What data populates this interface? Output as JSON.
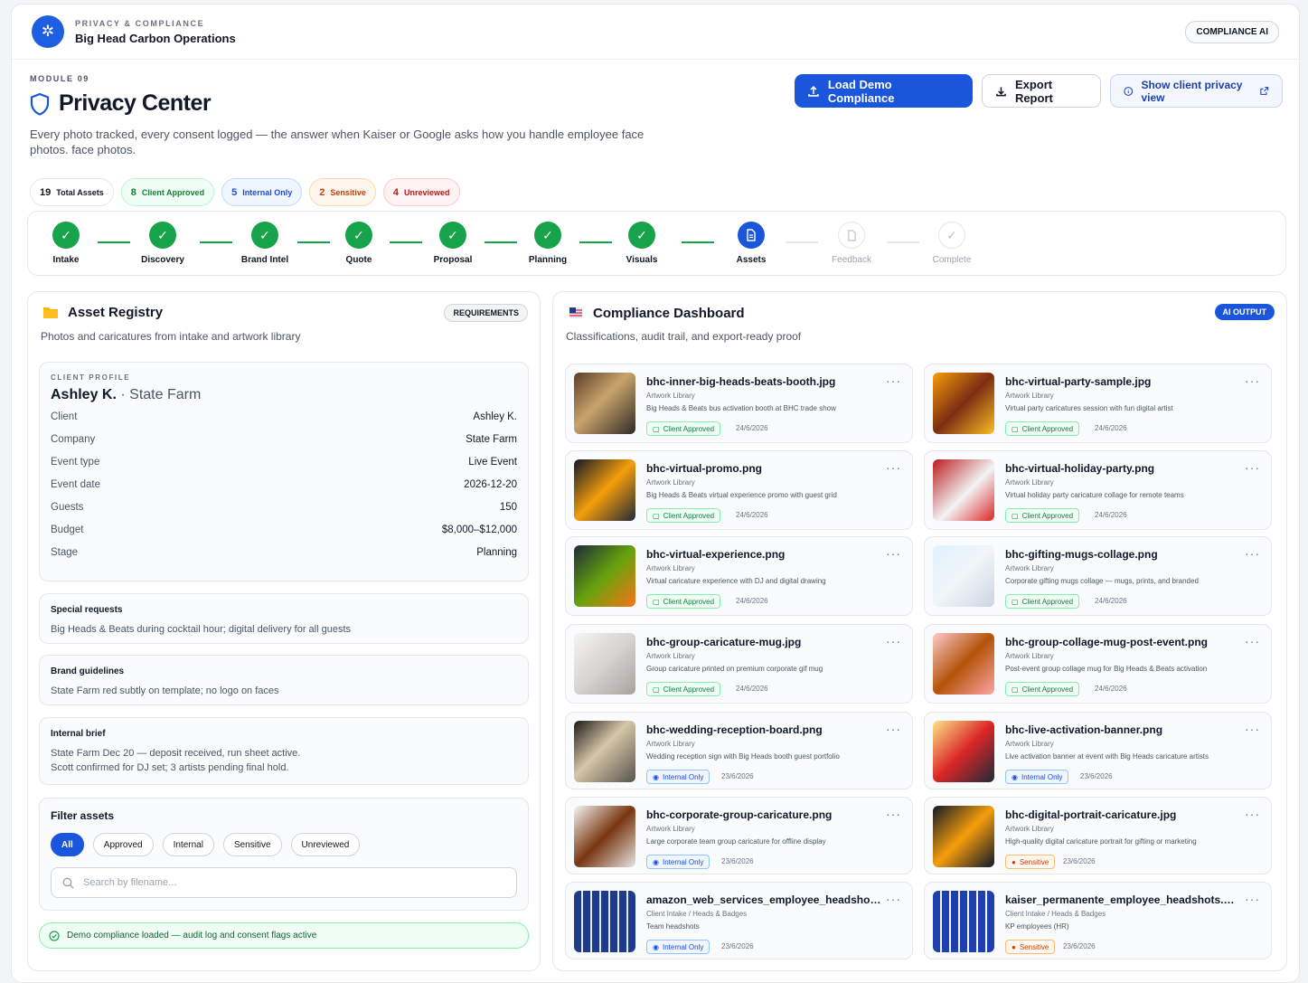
{
  "header": {
    "logo_glyph": "✲",
    "eyebrow": "PRIVACY & COMPLIANCE",
    "title": "Big Head Carbon Operations",
    "badge": "COMPLIANCE AI"
  },
  "page": {
    "module": "MODULE 09",
    "title": "Privacy Center",
    "subtitle": "Every photo tracked, every consent logged — the answer when Kaiser or Google asks how you handle employee face photos. face photos."
  },
  "actions": {
    "load_demo": "Load Demo Compliance",
    "export": "Export Report",
    "client_view": "Show client privacy view"
  },
  "stats": [
    {
      "count": "19",
      "label": "Total Assets"
    },
    {
      "count": "8",
      "label": "Client Approved"
    },
    {
      "count": "5",
      "label": "Internal Only"
    },
    {
      "count": "2",
      "label": "Sensitive"
    },
    {
      "count": "4",
      "label": "Unreviewed"
    }
  ],
  "steps": [
    {
      "label": "Intake",
      "state": "done"
    },
    {
      "label": "Discovery",
      "state": "done"
    },
    {
      "label": "Brand Intel",
      "state": "done"
    },
    {
      "label": "Quote",
      "state": "done"
    },
    {
      "label": "Proposal",
      "state": "done"
    },
    {
      "label": "Planning",
      "state": "done"
    },
    {
      "label": "Visuals",
      "state": "done"
    },
    {
      "label": "Assets",
      "state": "active"
    },
    {
      "label": "Feedback",
      "state": "pending"
    },
    {
      "label": "Complete",
      "state": "pending"
    }
  ],
  "registry": {
    "title": "Asset Registry",
    "tag": "REQUIREMENTS",
    "subtitle": "Photos and caricatures from intake and artwork library",
    "profile": {
      "eyebrow": "CLIENT PROFILE",
      "name": "Ashley K.",
      "company_suffix": "· State Farm",
      "rows": [
        {
          "k": "Client",
          "v": "Ashley K."
        },
        {
          "k": "Company",
          "v": "State Farm"
        },
        {
          "k": "Event type",
          "v": "Live Event"
        },
        {
          "k": "Event date",
          "v": "2026-12-20"
        },
        {
          "k": "Guests",
          "v": "150"
        },
        {
          "k": "Budget",
          "v": "$8,000–$12,000"
        },
        {
          "k": "Stage",
          "v": "Planning"
        }
      ]
    },
    "special": {
      "title": "Special requests",
      "text": "Big Heads & Beats during cocktail hour; digital delivery for all guests"
    },
    "brand": {
      "title": "Brand guidelines",
      "text": "State Farm red subtly on template; no logo on faces"
    },
    "brief": {
      "title": "Internal brief",
      "line1": "State Farm Dec 20 — deposit received, run sheet active.",
      "line2": "Scott confirmed for DJ set; 3 artists pending final hold."
    },
    "filter": {
      "title": "Filter assets",
      "chips": [
        "All",
        "Approved",
        "Internal",
        "Sensitive",
        "Unreviewed"
      ],
      "placeholder": "Search by filename..."
    },
    "toast": "Demo compliance loaded — audit log and consent flags active"
  },
  "dashboard": {
    "title": "Compliance Dashboard",
    "tag": "AI OUTPUT",
    "subtitle": "Classifications, audit trail, and export-ready proof",
    "more": "···",
    "assets": [
      {
        "name": "bhc-inner-big-heads-beats-booth.jpg",
        "source": "Artwork Library",
        "desc": "Big Heads & Beats bus activation booth at BHC trade show",
        "status": "Client Approved",
        "kind": "approved",
        "date": "24/6/2026"
      },
      {
        "name": "bhc-virtual-party-sample.jpg",
        "source": "Artwork Library",
        "desc": "Virtual party caricatures session with fun digital artist",
        "status": "Client Approved",
        "kind": "approved",
        "date": "24/6/2026"
      },
      {
        "name": "bhc-virtual-promo.png",
        "source": "Artwork Library",
        "desc": "Big Heads & Beats virtual experience promo with guest grid",
        "status": "Client Approved",
        "kind": "approved",
        "date": "24/6/2026"
      },
      {
        "name": "bhc-virtual-holiday-party.png",
        "source": "Artwork Library",
        "desc": "Virtual holiday party caricature collage for remote teams",
        "status": "Client Approved",
        "kind": "approved",
        "date": "24/6/2026"
      },
      {
        "name": "bhc-virtual-experience.png",
        "source": "Artwork Library",
        "desc": "Virtual caricature experience with DJ and digital drawing",
        "status": "Client Approved",
        "kind": "approved",
        "date": "24/6/2026"
      },
      {
        "name": "bhc-gifting-mugs-collage.png",
        "source": "Artwork Library",
        "desc": "Corporate gifting mugs collage — mugs, prints, and branded",
        "status": "Client Approved",
        "kind": "approved",
        "date": "24/6/2026"
      },
      {
        "name": "bhc-group-caricature-mug.jpg",
        "source": "Artwork Library",
        "desc": "Group caricature printed on premium corporate gif mug",
        "status": "Client Approved",
        "kind": "approved",
        "date": "24/6/2026"
      },
      {
        "name": "bhc-group-collage-mug-post-event.png",
        "source": "Artwork Library",
        "desc": "Post-event group collage mug for Big Heads & Beats activation",
        "status": "Client Approved",
        "kind": "approved",
        "date": "24/6/2026"
      },
      {
        "name": "bhc-wedding-reception-board.png",
        "source": "Artwork Library",
        "desc": "Wedding reception sign with Big Heads booth guest portfolio",
        "status": "Internal Only",
        "kind": "internal",
        "date": "23/6/2026"
      },
      {
        "name": "bhc-live-activation-banner.png",
        "source": "Artwork Library",
        "desc": "Live activation banner at event with Big Heads caricature artists",
        "status": "Internal Only",
        "kind": "internal",
        "date": "23/6/2026"
      },
      {
        "name": "bhc-corporate-group-caricature.png",
        "source": "Artwork Library",
        "desc": "Large corporate team group caricature for offline display",
        "status": "Internal Only",
        "kind": "internal",
        "date": "23/6/2026"
      },
      {
        "name": "bhc-digital-portrait-caricature.jpg",
        "source": "Artwork Library",
        "desc": "High-quality digital caricature portrait for gifting or marketing",
        "status": "Sensitive",
        "kind": "sensitive",
        "date": "23/6/2026"
      },
      {
        "name": "amazon_web_services_employee_headshot...",
        "source": "Client Intake / Heads & Badges",
        "desc": "Team headshots",
        "status": "Internal Only",
        "kind": "internal",
        "date": "23/6/2026"
      },
      {
        "name": "kaiser_permanente_employee_headshots.png",
        "source": "Client Intake / Heads & Badges",
        "desc": "KP employees (HR)",
        "status": "Sensitive",
        "kind": "sensitive",
        "date": "23/6/2026"
      }
    ]
  },
  "colors": {
    "primary": "#1a56db",
    "success": "#16a34a",
    "warning": "#c2410c",
    "danger": "#b91c1c"
  }
}
